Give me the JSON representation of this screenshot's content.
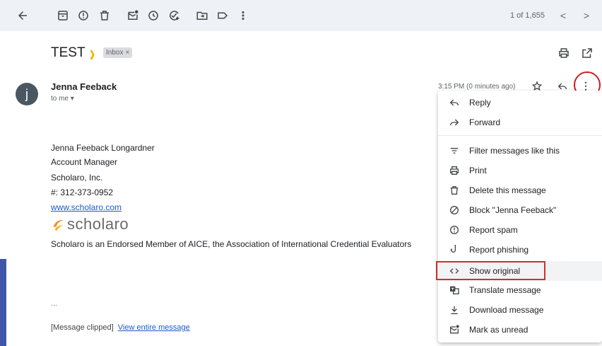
{
  "toolbar": {
    "icons": [
      "back-arrow-icon",
      "archive-icon",
      "report-spam-icon",
      "delete-icon",
      "mark-unread-icon",
      "snooze-icon",
      "add-task-icon",
      "move-to-icon",
      "label-icon",
      "more-vert-icon"
    ],
    "pager_text": "1 of 1,655",
    "prev": "<",
    "next": ">"
  },
  "email": {
    "subject": "TEST",
    "label": "Inbox",
    "label_close": "×",
    "sender": "Jenna Feeback",
    "avatar_letter": "j",
    "to": "to me ▾",
    "time": "3:15 PM (0 minutes ago)",
    "body": {
      "line1": "Jenna Feeback Longardner",
      "line2": "Account Manager",
      "line3": "Scholaro, Inc.",
      "line4": "#: 312-373-0952",
      "website": "www.scholaro.com",
      "logo_text": "scholaro",
      "endorse": "Scholaro is an Endorsed Member of AICE, the Association of International Credential Evaluators",
      "ellipsis": "...",
      "clipped": "[Message clipped]",
      "view_entire": "View entire message"
    }
  },
  "menu": {
    "items": [
      {
        "label": "Reply",
        "icon": "reply-icon"
      },
      {
        "label": "Forward",
        "icon": "forward-icon"
      },
      {
        "label": "Filter messages like this",
        "icon": "filter-icon"
      },
      {
        "label": "Print",
        "icon": "print-icon"
      },
      {
        "label": "Delete this message",
        "icon": "delete-icon"
      },
      {
        "label": "Block \"Jenna Feeback\"",
        "icon": "block-icon"
      },
      {
        "label": "Report spam",
        "icon": "report-spam-icon"
      },
      {
        "label": "Report phishing",
        "icon": "phishing-icon"
      },
      {
        "label": "Show original",
        "icon": "code-icon"
      },
      {
        "label": "Translate message",
        "icon": "translate-icon"
      },
      {
        "label": "Download message",
        "icon": "download-icon"
      },
      {
        "label": "Mark as unread",
        "icon": "mark-unread-icon"
      }
    ]
  },
  "colors": {
    "toolbar_bg": "#eef1f5",
    "highlight_red": "#d0312d",
    "link_blue": "#1a5dc5",
    "important_yellow": "#f5b400",
    "avatar_bg": "#4a5763"
  }
}
